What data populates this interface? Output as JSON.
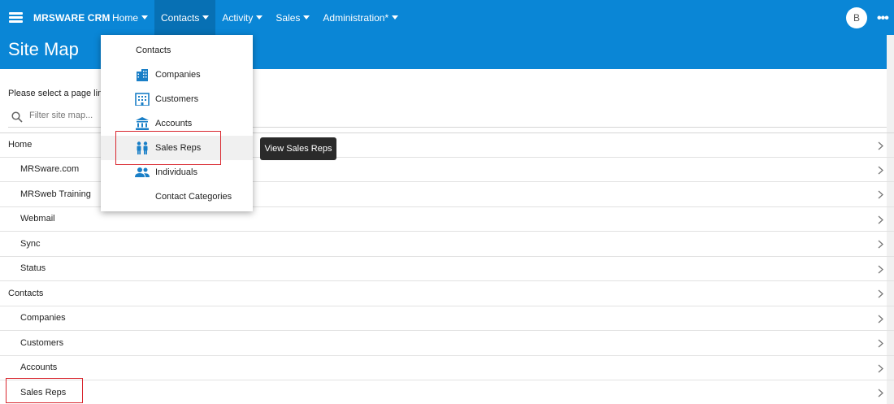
{
  "app": {
    "brand": "MRSWARE CRM",
    "avatar_initial": "B",
    "more_glyph": "•••"
  },
  "nav": [
    {
      "label": "Home"
    },
    {
      "label": "Contacts"
    },
    {
      "label": "Activity"
    },
    {
      "label": "Sales"
    },
    {
      "label": "Administration*"
    }
  ],
  "page": {
    "title": "Site Map",
    "prompt": "Please select a page link",
    "filter_placeholder": "Filter site map..."
  },
  "sitemap_rows": [
    {
      "label": "Home",
      "level": 0
    },
    {
      "label": "MRSware.com",
      "level": 1
    },
    {
      "label": "MRSweb Training",
      "level": 1
    },
    {
      "label": "Webmail",
      "level": 1
    },
    {
      "label": "Sync",
      "level": 1
    },
    {
      "label": "Status",
      "level": 1
    },
    {
      "label": "Contacts",
      "level": 0
    },
    {
      "label": "Companies",
      "level": 1
    },
    {
      "label": "Customers",
      "level": 1
    },
    {
      "label": "Accounts",
      "level": 1
    },
    {
      "label": "Sales Reps",
      "level": 1
    }
  ],
  "dropdown": {
    "header": "Contacts",
    "items": [
      {
        "label": "Companies",
        "icon": "companies-icon"
      },
      {
        "label": "Customers",
        "icon": "customers-icon"
      },
      {
        "label": "Accounts",
        "icon": "accounts-icon"
      },
      {
        "label": "Sales Reps",
        "icon": "sales-reps-icon"
      },
      {
        "label": "Individuals",
        "icon": "individuals-icon"
      },
      {
        "label": "Contact Categories",
        "icon": ""
      }
    ]
  },
  "tooltip": "View Sales Reps",
  "colors": {
    "brand_blue": "#0a86d6",
    "active_nav": "#0770b4",
    "icon_blue": "#1a7fc7",
    "highlight_red": "#d9262e"
  }
}
